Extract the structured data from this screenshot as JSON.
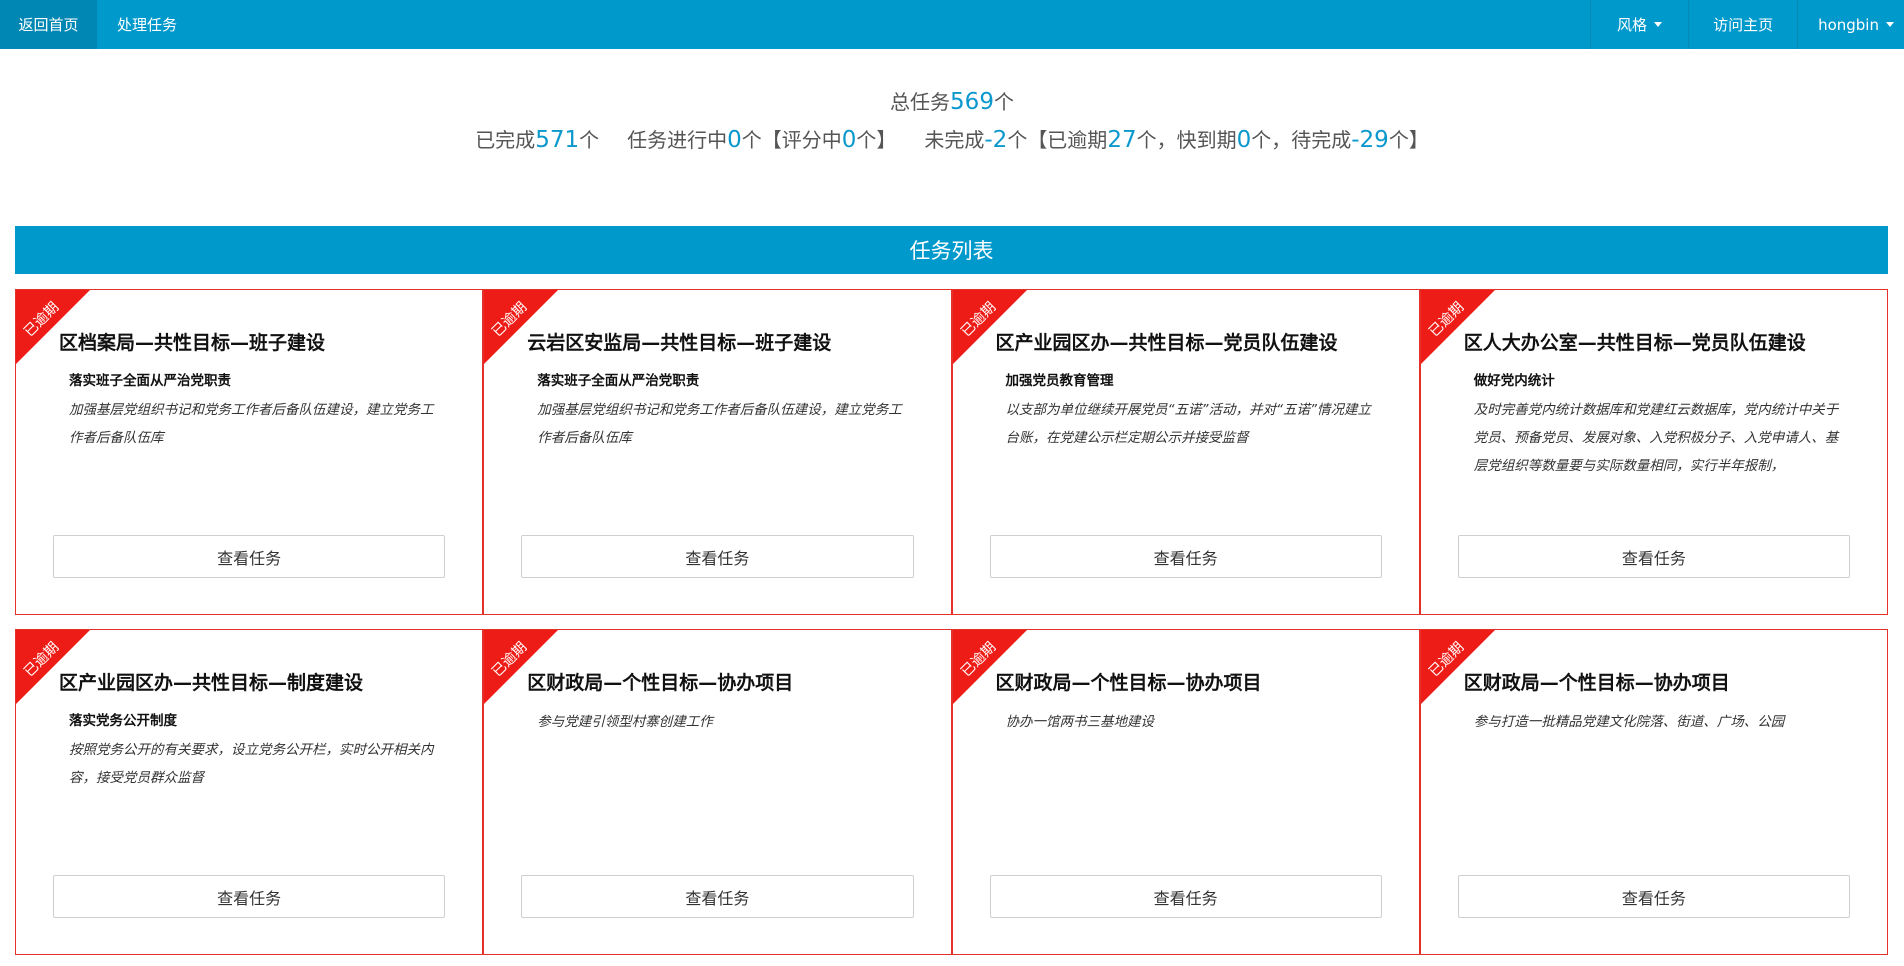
{
  "nav": {
    "home": "返回首页",
    "tasks": "处理任务",
    "style": "风格",
    "visit": "访问主页",
    "user": "hongbin"
  },
  "stats": {
    "total_label": "总任务",
    "total": "569",
    "unit": "个",
    "completed_label": "已完成",
    "completed": "571",
    "in_progress_label": "任务进行中",
    "in_progress": "0",
    "scoring_label": "【评分中",
    "scoring": "0",
    "incomplete_label": "未完成",
    "incomplete": "-2",
    "overdue_label": "【已逾期",
    "overdue": "27",
    "due_soon_label": "，快到期",
    "due_soon": "0",
    "pending_label": "，待完成",
    "pending": "-29",
    "close": "个】",
    "close_short": "个】"
  },
  "list_title": "任务列表",
  "cards": [
    {
      "ribbon": "已逾期",
      "title": "区档案局—共性目标—班子建设",
      "subtitle": "落实班子全面从严治党职责",
      "desc": "加强基层党组织书记和党务工作者后备队伍建设，建立党务工作者后备队伍库",
      "button": "查看任务"
    },
    {
      "ribbon": "已逾期",
      "title": "云岩区安监局—共性目标—班子建设",
      "subtitle": "落实班子全面从严治党职责",
      "desc": "加强基层党组织书记和党务工作者后备队伍建设，建立党务工作者后备队伍库",
      "button": "查看任务"
    },
    {
      "ribbon": "已逾期",
      "title": "区产业园区办—共性目标—党员队伍建设",
      "subtitle": "加强党员教育管理",
      "desc": "以支部为单位继续开展党员“五诺”活动，并对“五诺”情况建立台账，在党建公示栏定期公示并接受监督",
      "button": "查看任务"
    },
    {
      "ribbon": "已逾期",
      "title": "区人大办公室—共性目标—党员队伍建设",
      "subtitle": "做好党内统计",
      "desc": "及时完善党内统计数据库和党建红云数据库，党内统计中关于党员、预备党员、发展对象、入党积极分子、入党申请人、基层党组织等数量要与实际数量相同，实行半年报制，",
      "button": "查看任务"
    },
    {
      "ribbon": "已逾期",
      "title": "区产业园区办—共性目标—制度建设",
      "subtitle": "落实党务公开制度",
      "desc": "按照党务公开的有关要求，设立党务公开栏，实时公开相关内容，接受党员群众监督",
      "button": "查看任务"
    },
    {
      "ribbon": "已逾期",
      "title": "区财政局—个性目标—协办项目",
      "subtitle": "",
      "desc": "参与党建引领型村寨创建工作",
      "button": "查看任务"
    },
    {
      "ribbon": "已逾期",
      "title": "区财政局—个性目标—协办项目",
      "subtitle": "",
      "desc": "协办一馆两书三基地建设",
      "button": "查看任务"
    },
    {
      "ribbon": "已逾期",
      "title": "区财政局—个性目标—协办项目",
      "subtitle": "",
      "desc": "参与打造一批精品党建文化院落、街道、广场、公园",
      "button": "查看任务"
    }
  ]
}
